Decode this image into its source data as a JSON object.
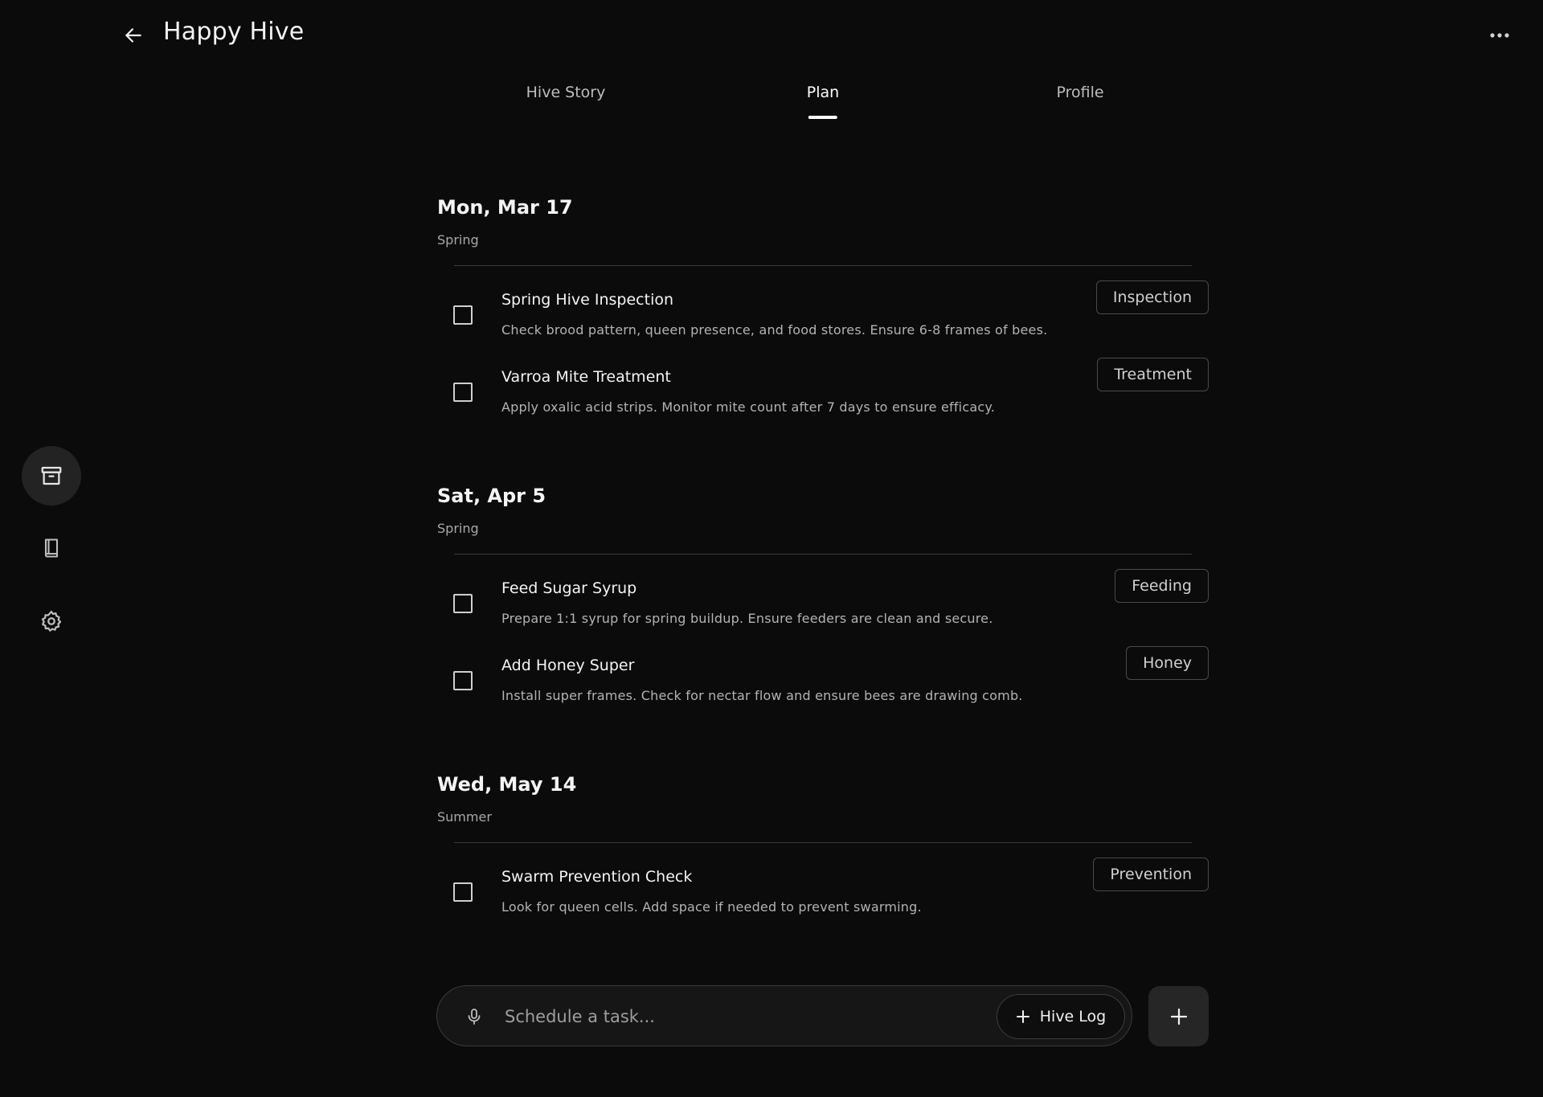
{
  "header": {
    "title": "Happy Hive",
    "back_icon": "arrow-left-icon",
    "more_icon": "more-horizontal-icon"
  },
  "tabs": [
    {
      "label": "Hive Story",
      "active": false
    },
    {
      "label": "Plan",
      "active": true
    },
    {
      "label": "Profile",
      "active": false
    }
  ],
  "sidebar": {
    "items": [
      {
        "icon": "archive-icon",
        "active": true
      },
      {
        "icon": "book-icon",
        "active": false
      },
      {
        "icon": "gear-icon",
        "active": false
      }
    ]
  },
  "groups": [
    {
      "date": "Mon, Mar 17",
      "season": "Spring",
      "tasks": [
        {
          "title": "Spring Hive Inspection",
          "description": "Check brood pattern, queen presence, and food stores. Ensure 6-8 frames of bees.",
          "tag": "Inspection"
        },
        {
          "title": "Varroa Mite Treatment",
          "description": "Apply oxalic acid strips. Monitor mite count after 7 days to ensure efficacy.",
          "tag": "Treatment"
        }
      ]
    },
    {
      "date": "Sat, Apr 5",
      "season": "Spring",
      "tasks": [
        {
          "title": "Feed Sugar Syrup",
          "description": "Prepare 1:1 syrup for spring buildup. Ensure feeders are clean and secure.",
          "tag": "Feeding"
        },
        {
          "title": "Add Honey Super",
          "description": "Install super frames. Check for nectar flow and ensure bees are drawing comb.",
          "tag": "Honey"
        }
      ]
    },
    {
      "date": "Wed, May 14",
      "season": "Summer",
      "tasks": [
        {
          "title": "Swarm Prevention Check",
          "description": "Look for queen cells. Add space if needed to prevent swarming.",
          "tag": "Prevention"
        }
      ]
    }
  ],
  "composer": {
    "placeholder": "Schedule a task...",
    "value": "",
    "hive_log_label": "Hive Log",
    "mic_icon": "microphone-icon",
    "add_icon": "plus-icon"
  },
  "colors": {
    "background": "#0b0b0b",
    "text": "#f4f4f4",
    "muted": "#b3b3b3",
    "border": "#3a3a3a",
    "sidebar_active": "#232323"
  }
}
